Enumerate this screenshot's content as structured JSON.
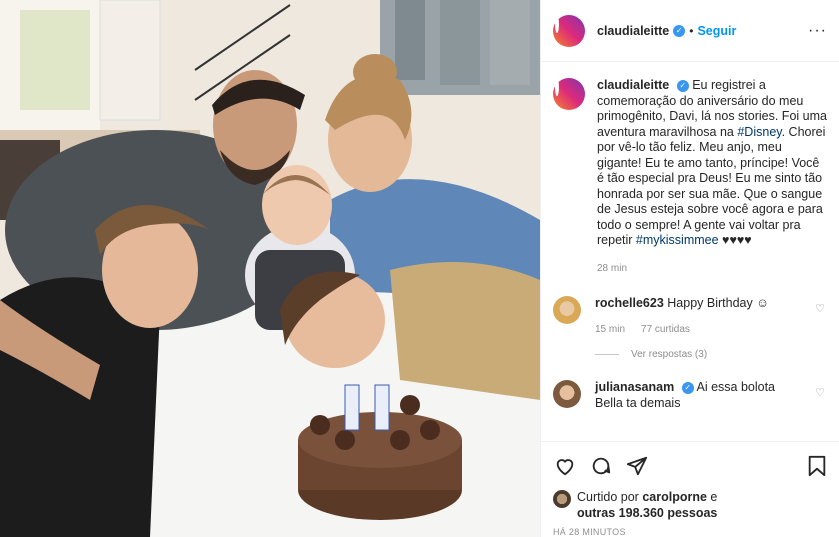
{
  "post": {
    "username": "claudialeitte",
    "follow_label": "Seguir",
    "more_icon": "more-horizontal-icon",
    "caption_parts": {
      "p1": "Eu registrei a comemoração do aniversário do meu primogênito, Davi, lá nos stories. Foi uma aventura maravilhosa na ",
      "tag1": "#Disney",
      "p2": ". Chorei por vê-lo tão feliz. Meu anjo, meu gigante! Eu te amo tanto, príncipe! Você é tão especial pra Deus! Eu me sinto tão honrada por ser sua mãe. Que o sangue de Jesus esteja sobre você agora e para todo o sempre! A gente vai voltar pra repetir ",
      "tag2": "#mykissimmee",
      "p3": " ♥♥♥♥"
    },
    "caption_time": "28 min"
  },
  "comments": [
    {
      "username": "rochelle623",
      "text": "Happy Birthday ☺",
      "time": "15 min",
      "likes": "77 curtidas",
      "replies": "Ver respostas (3)",
      "avatar_color": "#e8c27a"
    },
    {
      "username": "julianasanam",
      "text": "Ai essa bolota Bella ta demais",
      "avatar_color": "#c79a6c"
    }
  ],
  "likes": {
    "prefix": "Curtido por",
    "user": "carolporne",
    "mid": "e",
    "others": "outras 198.360 pessoas"
  },
  "timestamp": "HÁ 28 MINUTOS",
  "colors": {
    "accent": "#0095f6",
    "verified": "#3897f0",
    "hashtag": "#00376b",
    "muted": "#8e8e8e"
  }
}
